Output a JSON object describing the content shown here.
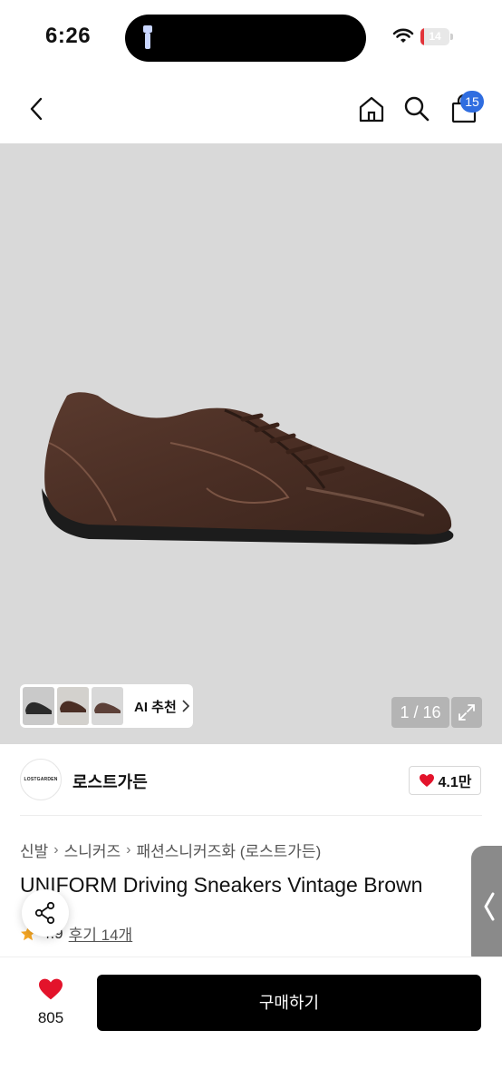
{
  "status_bar": {
    "time": "6:26",
    "battery": "14",
    "battery_level": 0.14
  },
  "nav": {
    "cart_count": "15"
  },
  "gallery": {
    "ai_recommend_label": "AI 추천",
    "counter": "1 / 16"
  },
  "brand": {
    "name": "로스트가든",
    "logo_text": "LOSTGARDEN",
    "likes": "4.1만"
  },
  "breadcrumb": [
    "신발",
    "스니커즈",
    "패션스니커즈화 (로스트가든)"
  ],
  "product": {
    "title": "UNIFORM Driving Sneakers Vintage Brown",
    "rating": "4.9",
    "reviews": "후기 14개"
  },
  "bottom": {
    "wish_count": "805",
    "buy_label": "구매하기"
  },
  "colors": {
    "accent": "#2f6de0",
    "heart": "#e3132b",
    "buy_button": "#000000"
  }
}
